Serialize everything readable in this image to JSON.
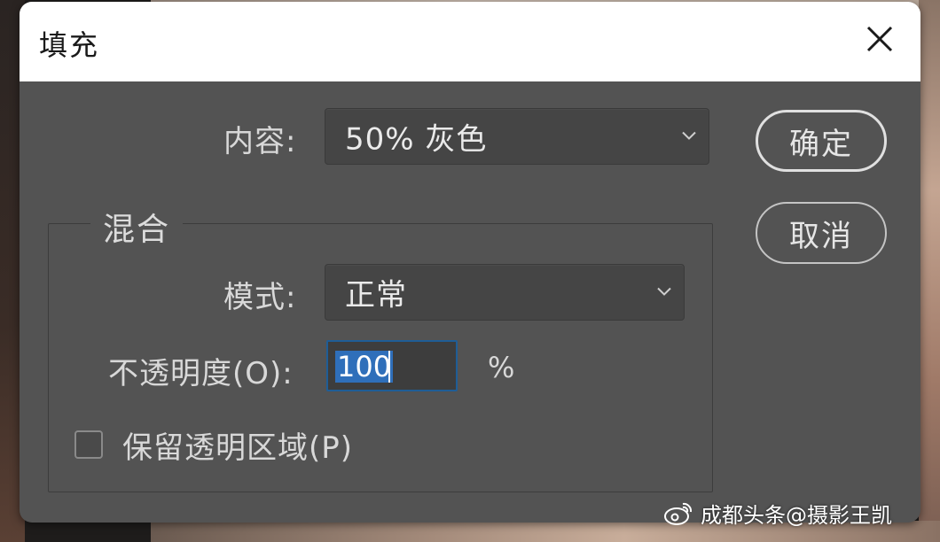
{
  "dialog": {
    "title": "填充",
    "content_label": "内容:",
    "content_value": "50% 灰色",
    "ok_button": "确定",
    "cancel_button": "取消"
  },
  "blending": {
    "legend": "混合",
    "mode_label": "模式:",
    "mode_value": "正常",
    "opacity_label": "不透明度(O):",
    "opacity_value": "100",
    "opacity_unit": "%",
    "preserve_transparency_label": "保留透明区域(P)",
    "preserve_transparency_checked": false
  },
  "watermark": {
    "text": "成都头条@摄影王凯",
    "icon": "weibo-icon"
  },
  "colors": {
    "dialog_bg": "#535353",
    "titlebar_bg": "#ffffff",
    "focus_border": "#1f5d96",
    "selection": "#2f6fba"
  }
}
